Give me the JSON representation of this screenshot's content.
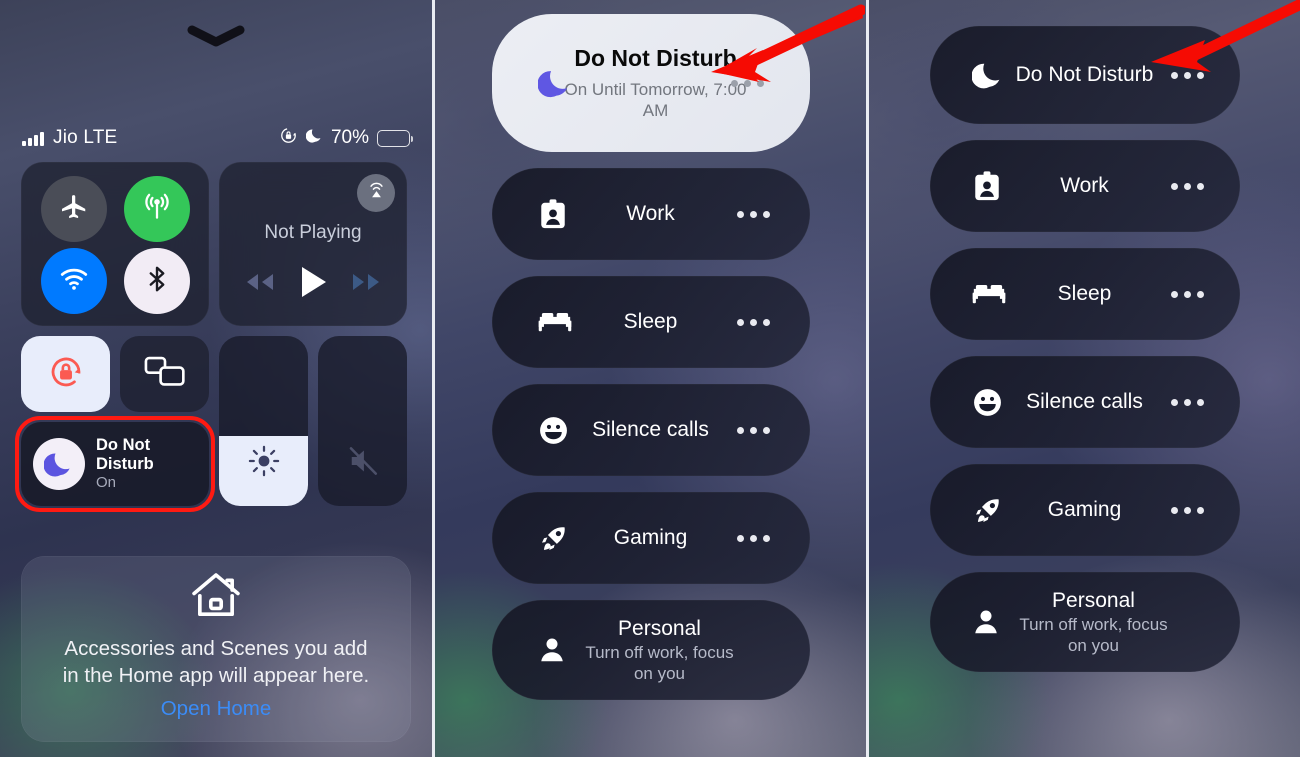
{
  "panel1": {
    "status_bar": {
      "carrier": "Jio LTE",
      "battery_percent": "70%",
      "rotation_lock_icon": "rotation-lock-icon",
      "dnd_icon": "moon-icon",
      "signal_icon": "signal-bars-icon",
      "battery_icon": "battery-icon"
    },
    "grabber_icon": "chevron-down-icon",
    "connectivity": {
      "airplane_mode": {
        "icon": "airplane-icon",
        "state": "off"
      },
      "cellular_data": {
        "icon": "cellular-icon",
        "state": "on"
      },
      "wifi": {
        "icon": "wifi-icon",
        "state": "on"
      },
      "bluetooth": {
        "icon": "bluetooth-icon",
        "state": "on"
      }
    },
    "media": {
      "title": "Not Playing",
      "airplay_icon": "airplay-icon",
      "rewind_icon": "rewind-icon",
      "play_icon": "play-icon",
      "forward_icon": "fast-forward-icon"
    },
    "rotation_lock_tile": {
      "icon": "rotation-lock-icon",
      "state": "on"
    },
    "screen_mirroring_tile": {
      "icon": "screen-mirroring-icon",
      "state": "off"
    },
    "dnd_tile": {
      "title_line1": "Do Not",
      "title_line2": "Disturb",
      "status": "On",
      "icon": "moon-icon",
      "highlight_color": "#ff1a12"
    },
    "brightness": {
      "icon": "brightness-icon",
      "level_percent": 41
    },
    "volume": {
      "icon": "volume-mute-icon",
      "level_percent": 0
    },
    "home": {
      "icon": "home-icon",
      "text_line1": "Accessories and Scenes you add",
      "text_line2": "in the Home app will appear here.",
      "link_label": "Open Home",
      "link_color": "#3b8cf7"
    }
  },
  "panel2": {
    "arrow_color": "#f60b03",
    "focus_items": [
      {
        "name": "Do Not Disturb",
        "sub": "On Until Tomorrow, 7:00 AM",
        "icon": "moon-icon",
        "state": "active",
        "more_icon": "more-options-icon"
      },
      {
        "name": "Work",
        "sub": "",
        "icon": "id-badge-icon",
        "state": "inactive",
        "more_icon": "more-options-icon"
      },
      {
        "name": "Sleep",
        "sub": "",
        "icon": "bed-icon",
        "state": "inactive",
        "more_icon": "more-options-icon"
      },
      {
        "name": "Silence calls",
        "sub": "",
        "icon": "smiley-icon",
        "state": "inactive",
        "more_icon": "more-options-icon"
      },
      {
        "name": "Gaming",
        "sub": "",
        "icon": "rocket-icon",
        "state": "inactive",
        "more_icon": "more-options-icon"
      },
      {
        "name": "Personal",
        "sub": "Turn off work, focus on you",
        "icon": "person-icon",
        "state": "inactive",
        "more_icon": ""
      }
    ]
  },
  "panel3": {
    "arrow_color": "#f60b03",
    "focus_items": [
      {
        "name": "Do Not Disturb",
        "sub": "",
        "icon": "moon-icon",
        "state": "inactive",
        "more_icon": "more-options-icon"
      },
      {
        "name": "Work",
        "sub": "",
        "icon": "id-badge-icon",
        "state": "inactive",
        "more_icon": "more-options-icon"
      },
      {
        "name": "Sleep",
        "sub": "",
        "icon": "bed-icon",
        "state": "inactive",
        "more_icon": "more-options-icon"
      },
      {
        "name": "Silence calls",
        "sub": "",
        "icon": "smiley-icon",
        "state": "inactive",
        "more_icon": "more-options-icon"
      },
      {
        "name": "Gaming",
        "sub": "",
        "icon": "rocket-icon",
        "state": "inactive",
        "more_icon": "more-options-icon"
      },
      {
        "name": "Personal",
        "sub": "Turn off work, focus on you",
        "icon": "person-icon",
        "state": "inactive",
        "more_icon": ""
      }
    ]
  }
}
